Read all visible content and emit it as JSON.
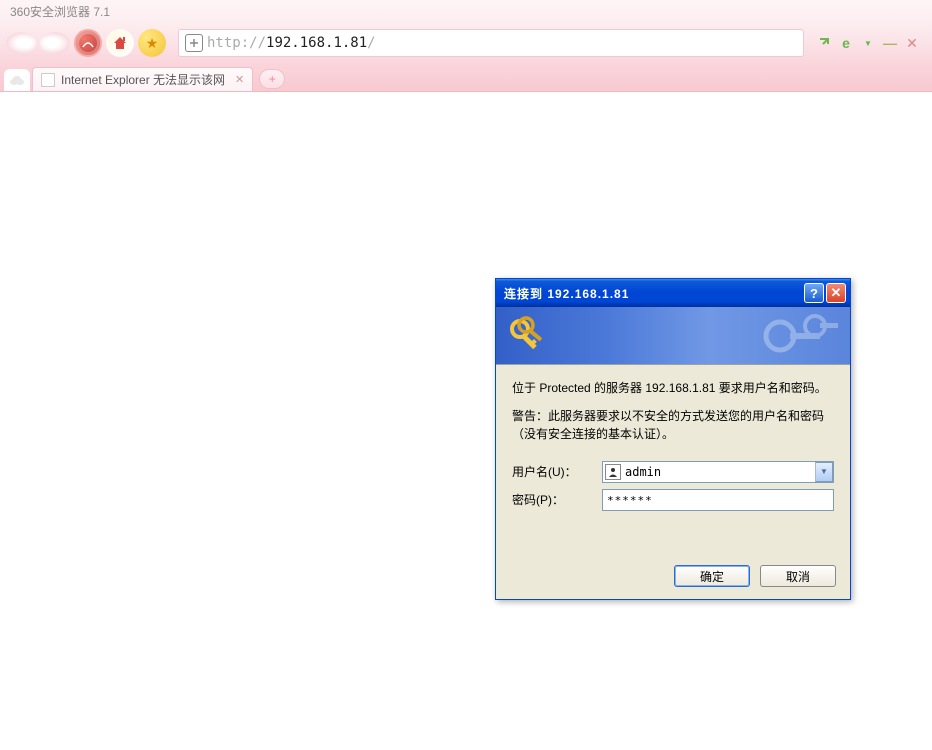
{
  "browser": {
    "title": "360安全浏览器 7.1",
    "url_prefix": "http://",
    "url_host": "192.168.1.81",
    "url_suffix": "/"
  },
  "tab": {
    "title": "Internet Explorer 无法显示该网"
  },
  "dialog": {
    "title": "连接到 192.168.1.81",
    "message1": "位于 Protected 的服务器 192.168.1.81 要求用户名和密码。",
    "message2": "警告：此服务器要求以不安全的方式发送您的用户名和密码（没有安全连接的基本认证）。",
    "username_label": "用户名(U)：",
    "username_value": "admin",
    "password_label": "密码(P)：",
    "password_value": "******",
    "ok_label": "确定",
    "cancel_label": "取消"
  }
}
